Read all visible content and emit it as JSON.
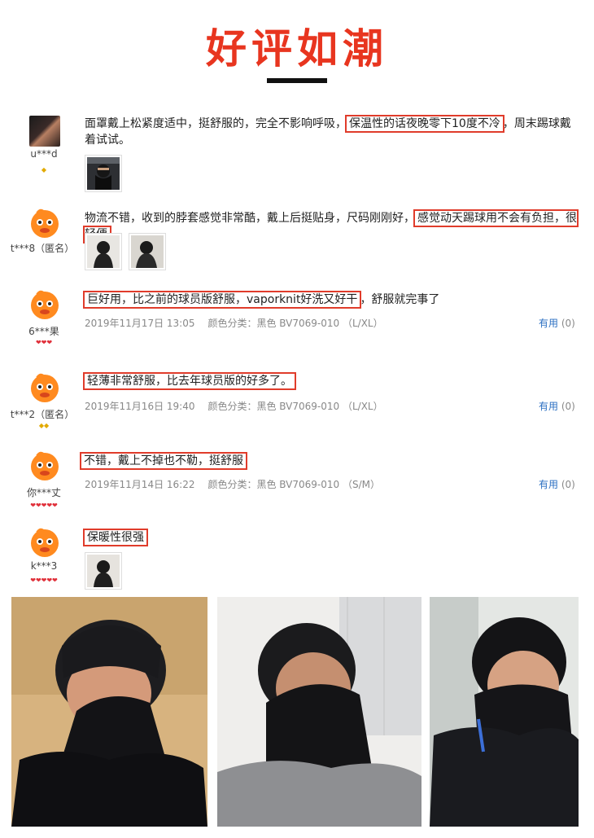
{
  "header": {
    "title": "好评如潮"
  },
  "reviews": [
    {
      "user": "u***d",
      "text_before": "面罩戴上松紧度适中，挺舒服的，完全不影响呼吸，",
      "highlight": "保温性的话夜晚零下10度不冷",
      "text_after": "，周末踢球戴着试试。"
    },
    {
      "user": "t***8（匿名）",
      "text_before": "物流不错，收到的脖套感觉非常酷，戴上后挺贴身，尺码刚刚好，",
      "highlight": "感觉动天踢球用不会有负担，很轻便",
      "text_after": ""
    },
    {
      "user": "6***果",
      "text_before": "",
      "highlight": "巨好用，比之前的球员版舒服，vaporknit好洗又好干",
      "text_after": "，舒服就完事了",
      "date": "2019年11月17日 13:05",
      "color": "颜色分类：黑色 BV7069-010 （L/XL）",
      "useful_label": "有用",
      "useful_count": "(0)"
    },
    {
      "user": "t***2（匿名）",
      "text_before": "",
      "highlight": "轻薄非常舒服，比去年球员版的好多了。",
      "text_after": "",
      "date": "2019年11月16日 19:40",
      "color": "颜色分类：黑色 BV7069-010 （L/XL）",
      "useful_label": "有用",
      "useful_count": "(0)"
    },
    {
      "user": "你***丈",
      "text_before": "",
      "highlight": "不错，戴上不掉也不勒，挺舒服",
      "text_after": "",
      "date": "2019年11月14日 16:22",
      "color": "颜色分类：黑色 BV7069-010 （S/M）",
      "useful_label": "有用",
      "useful_count": "(0)"
    },
    {
      "user": "k***3",
      "text_before": "",
      "highlight": "保暖性很强",
      "text_after": ""
    }
  ],
  "badges": {
    "diamond1": "◆",
    "diamond2": "◆◆",
    "heart3": "❤❤❤",
    "heart5": "❤❤❤❤❤"
  },
  "colors": {
    "accent": "#e8351f",
    "link": "#2b6fc2"
  }
}
